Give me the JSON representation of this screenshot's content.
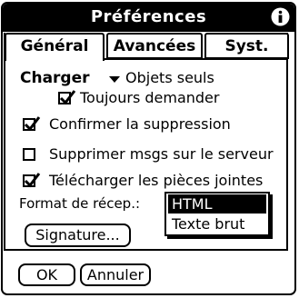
{
  "dialog": {
    "title": "Préférences"
  },
  "tabs": [
    {
      "label": "Général",
      "active": true
    },
    {
      "label": "Avancées",
      "active": false
    },
    {
      "label": "Syst.",
      "active": false
    }
  ],
  "general": {
    "charger_label": "Charger",
    "charger_value": "Objets seuls",
    "always_ask": {
      "label": "Toujours demander",
      "checked": true
    },
    "confirm_delete": {
      "label": "Confirmer la suppression",
      "checked": true
    },
    "delete_on_server": {
      "label": "Supprimer msgs sur le serveur",
      "checked": false
    },
    "download_attachments": {
      "label": "Télécharger les pièces jointes",
      "checked": true
    },
    "receive_format_label": "Format de récep.:",
    "signature_button": "Signature..."
  },
  "format_popup": {
    "options": [
      "HTML",
      "Texte brut"
    ],
    "selected": "HTML"
  },
  "buttons": {
    "ok": "OK",
    "cancel": "Annuler"
  }
}
